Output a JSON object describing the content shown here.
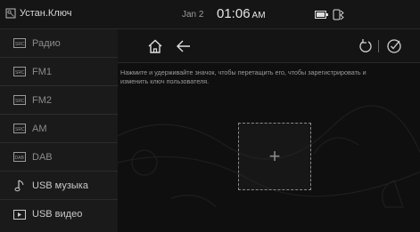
{
  "header": {
    "app_title": "Устан.Ключ",
    "date": "Jan 2",
    "time": "01:06",
    "ampm": "AM",
    "icons": [
      "settings-key-icon",
      "battery-icon",
      "bluetooth-phone-icon"
    ]
  },
  "sidebar": {
    "items": [
      {
        "label": "Радио",
        "icon": "radio-icon"
      },
      {
        "label": "FM1",
        "icon": "radio-icon"
      },
      {
        "label": "FM2",
        "icon": "radio-icon"
      },
      {
        "label": "AM",
        "icon": "radio-icon"
      },
      {
        "label": "DAB",
        "icon": "dab-icon"
      },
      {
        "label": "USB музыка",
        "icon": "music-note-icon"
      },
      {
        "label": "USB видео",
        "icon": "video-icon"
      }
    ]
  },
  "toolbar": {
    "home": "home-icon",
    "back": "back-arrow-icon",
    "reset": "undo-icon",
    "confirm": "check-circle-icon"
  },
  "main": {
    "instruction": "Нажмите и удерживайте значок, чтобы перетащить его, чтобы зарегистрировать и изменить ключ пользователя.",
    "add_symbol": "+"
  },
  "colors": {
    "background": "#000000",
    "sidebar_bg": "#1a1a1a",
    "text_dim": "#8c8c8c",
    "text_bright": "#e6e6e6"
  }
}
